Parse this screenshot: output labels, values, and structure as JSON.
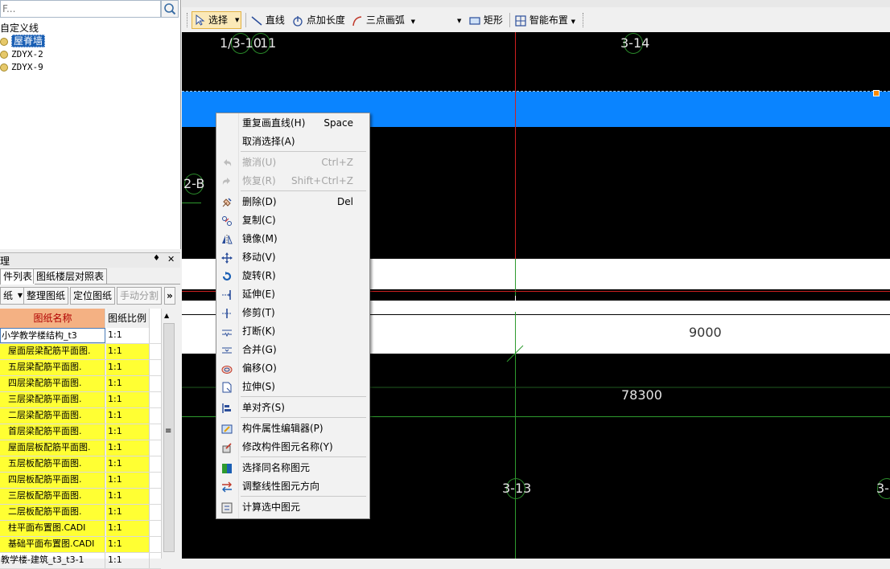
{
  "left_tree": {
    "search_placeholder": "F...",
    "root_label": "自定义线",
    "items": [
      {
        "label": "屋脊墙",
        "selected": true
      },
      {
        "label": "ZDYX-2",
        "selected": false
      },
      {
        "label": "ZDYX-9",
        "selected": false
      }
    ]
  },
  "drawing_panel": {
    "title": "理",
    "pin_glyph": "♦",
    "close_glyph": "✕",
    "tabs": [
      "件列表",
      "图纸楼层对照表"
    ],
    "buttons": [
      "纸",
      "整理图纸",
      "定位图纸",
      "手动分割"
    ],
    "overflow_glyph": "»",
    "columns": [
      "图纸名称",
      "图纸比例"
    ],
    "rows": [
      {
        "name": "小学教学楼结构_t3",
        "scale": "1:1",
        "highlight": false
      },
      {
        "name": "屋面层梁配筋平面图.",
        "scale": "1:1",
        "highlight": true
      },
      {
        "name": "五层梁配筋平面图.",
        "scale": "1:1",
        "highlight": true
      },
      {
        "name": "四层梁配筋平面图.",
        "scale": "1:1",
        "highlight": true
      },
      {
        "name": "三层梁配筋平面图.",
        "scale": "1:1",
        "highlight": true
      },
      {
        "name": "二层梁配筋平面图.",
        "scale": "1:1",
        "highlight": true
      },
      {
        "name": "首层梁配筋平面图.",
        "scale": "1:1",
        "highlight": true
      },
      {
        "name": "屋面层板配筋平面图.",
        "scale": "1:1",
        "highlight": true
      },
      {
        "name": "五层板配筋平面图.",
        "scale": "1:1",
        "highlight": true
      },
      {
        "name": "四层板配筋平面图.",
        "scale": "1:1",
        "highlight": true
      },
      {
        "name": "三层板配筋平面图.",
        "scale": "1:1",
        "highlight": true
      },
      {
        "name": "二层板配筋平面图.",
        "scale": "1:1",
        "highlight": true
      },
      {
        "name": "柱平面布置图.CADI",
        "scale": "1:1",
        "highlight": true
      },
      {
        "name": "基础平面布置图.CADI",
        "scale": "1:1",
        "highlight": true
      },
      {
        "name": "教学楼-建筑_t3_t3-1",
        "scale": "1:1",
        "highlight": false
      }
    ],
    "scroll_grip": "≡"
  },
  "toolbar": {
    "select_label": "选择",
    "line_label": "直线",
    "point_length_label": "点加长度",
    "arc_label": "三点画弧",
    "rect_label": "矩形",
    "smart_layout_label": "智能布置"
  },
  "canvas": {
    "axis_labels": [
      "1/3-10",
      "11",
      "3-14",
      "2-B",
      "3-13",
      "3-"
    ],
    "dim_labels": [
      "9000",
      "78300"
    ],
    "colors": {
      "background": "#000000",
      "wall": "#0a84ff",
      "grid_green": "#2e9a2e",
      "grid_red": "#d02020"
    }
  },
  "context_menu": {
    "items": [
      {
        "label": "重复画直线(H)",
        "shortcut": "Space",
        "icon": "none",
        "disabled": false
      },
      {
        "label": "取消选择(A)",
        "shortcut": "",
        "icon": "none",
        "disabled": false
      },
      {
        "label": "撤消(U)",
        "shortcut": "Ctrl+Z",
        "icon": "undo-icon",
        "disabled": true
      },
      {
        "label": "恢复(R)",
        "shortcut": "Shift+Ctrl+Z",
        "icon": "redo-icon",
        "disabled": true
      },
      {
        "label": "删除(D)",
        "shortcut": "Del",
        "icon": "delete-icon",
        "disabled": false
      },
      {
        "label": "复制(C)",
        "shortcut": "",
        "icon": "copy-icon",
        "disabled": false
      },
      {
        "label": "镜像(M)",
        "shortcut": "",
        "icon": "mirror-icon",
        "disabled": false
      },
      {
        "label": "移动(V)",
        "shortcut": "",
        "icon": "move-icon",
        "disabled": false
      },
      {
        "label": "旋转(R)",
        "shortcut": "",
        "icon": "rotate-icon",
        "disabled": false
      },
      {
        "label": "延伸(E)",
        "shortcut": "",
        "icon": "extend-icon",
        "disabled": false
      },
      {
        "label": "修剪(T)",
        "shortcut": "",
        "icon": "trim-icon",
        "disabled": false
      },
      {
        "label": "打断(K)",
        "shortcut": "",
        "icon": "break-icon",
        "disabled": false
      },
      {
        "label": "合并(G)",
        "shortcut": "",
        "icon": "merge-icon",
        "disabled": false
      },
      {
        "label": "偏移(O)",
        "shortcut": "",
        "icon": "offset-icon",
        "disabled": false
      },
      {
        "label": "拉伸(S)",
        "shortcut": "",
        "icon": "stretch-icon",
        "disabled": false
      },
      {
        "label": "单对齐(S)",
        "shortcut": "",
        "icon": "align-icon",
        "disabled": false
      },
      {
        "label": "构件属性编辑器(P)",
        "shortcut": "",
        "icon": "property-editor-icon",
        "disabled": false
      },
      {
        "label": "修改构件图元名称(Y)",
        "shortcut": "",
        "icon": "rename-icon",
        "disabled": false
      },
      {
        "label": "选择同名称图元",
        "shortcut": "",
        "icon": "select-same-icon",
        "disabled": false
      },
      {
        "label": "调整线性图元方向",
        "shortcut": "",
        "icon": "direction-icon",
        "disabled": false
      },
      {
        "label": "计算选中图元",
        "shortcut": "",
        "icon": "calculate-icon",
        "disabled": false
      }
    ]
  }
}
